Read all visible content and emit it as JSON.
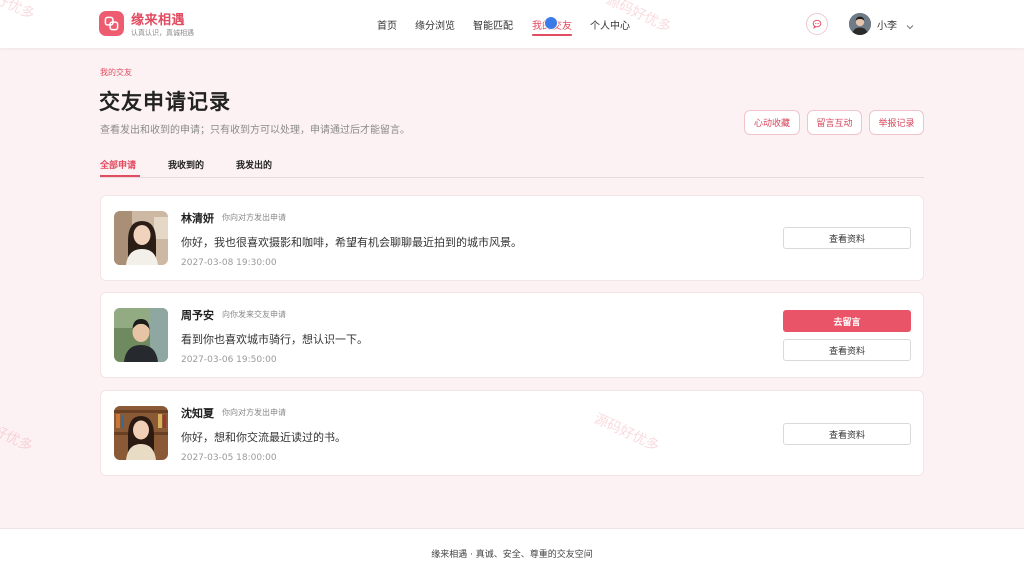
{
  "brand": {
    "name": "缘来相遇",
    "tagline": "认真认识，真诚相遇"
  },
  "nav": {
    "items": [
      {
        "label": "首页"
      },
      {
        "label": "缘分浏览"
      },
      {
        "label": "智能匹配"
      },
      {
        "label": "我的交友",
        "active": true
      },
      {
        "label": "个人中心"
      }
    ]
  },
  "user": {
    "name": "小李"
  },
  "header": {
    "breadcrumb": "我的交友",
    "title": "交友申请记录",
    "description": "查看发出和收到的申请；只有收到方可以处理，申请通过后才能留言。",
    "actions": [
      "心动收藏",
      "留言互动",
      "举报记录"
    ]
  },
  "tabs": [
    "全部申请",
    "我收到的",
    "我发出的"
  ],
  "requests": [
    {
      "name": "林清妍",
      "direction": "你向对方发出申请",
      "message": "你好，我也很喜欢摄影和咖啡，希望有机会聊聊最近拍到的城市风景。",
      "time": "2027-03-08 19:30:00",
      "view_label": "查看资料"
    },
    {
      "name": "周予安",
      "direction": "向你发来交友申请",
      "message": "看到你也喜欢城市骑行，想认识一下。",
      "time": "2027-03-06 19:50:00",
      "primary_label": "去留言",
      "view_label": "查看资料"
    },
    {
      "name": "沈知夏",
      "direction": "你向对方发出申请",
      "message": "你好，想和你交流最近读过的书。",
      "time": "2027-03-05 18:00:00",
      "view_label": "查看资料"
    }
  ],
  "footer": {
    "text": "缘来相遇 · 真诚、安全、尊重的交友空间"
  },
  "watermarks": [
    "源码好优多",
    "好优多",
    "源码好优多",
    "好优多"
  ],
  "colors": {
    "accent": "#e14c61",
    "primary_button": "#ea5468",
    "background": "#fdf2f3"
  }
}
